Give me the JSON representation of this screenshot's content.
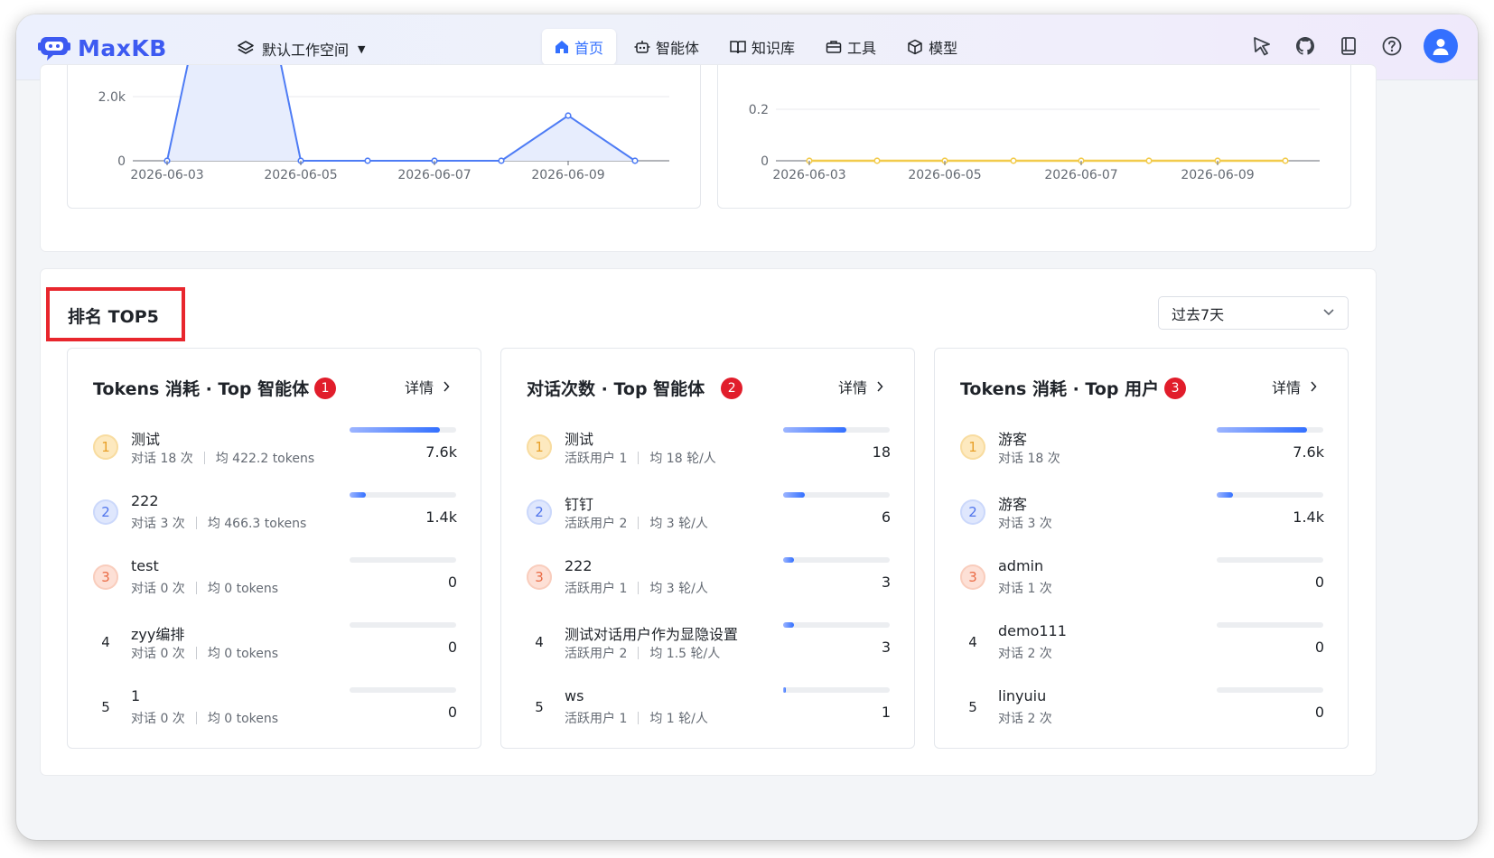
{
  "app": {
    "name": "MaxKB",
    "workspace": "默认工作空间"
  },
  "nav": [
    {
      "label": "首页",
      "icon": "home-icon",
      "active": true
    },
    {
      "label": "智能体",
      "icon": "robot-icon",
      "active": false
    },
    {
      "label": "知识库",
      "icon": "book-open-icon",
      "active": false
    },
    {
      "label": "工具",
      "icon": "toolbox-icon",
      "active": false
    },
    {
      "label": "模型",
      "icon": "cube-icon",
      "active": false
    }
  ],
  "header_icons": [
    "cursor-icon",
    "github-icon",
    "docs-icon",
    "help-icon",
    "user-avatar"
  ],
  "charts": {
    "left": {
      "y_ticks": [
        "2.0k",
        "0"
      ],
      "x_ticks": [
        "2026-06-03",
        "2026-06-05",
        "2026-06-07",
        "2026-06-09"
      ],
      "color": "#4e7cf5"
    },
    "right": {
      "y_ticks": [
        "0.2",
        "0"
      ],
      "x_ticks": [
        "2026-06-03",
        "2026-06-05",
        "2026-06-07",
        "2026-06-09"
      ],
      "color": "#f2cb4c"
    }
  },
  "ranking": {
    "title": "排名 TOP5",
    "period": "过去7天",
    "detail_label": "详情",
    "cards": [
      {
        "title": "Tokens 消耗 · Top 智能体",
        "badge": "1",
        "rows": [
          {
            "rank": "1",
            "name": "测试",
            "sub1": "对话 18 次",
            "sub2": "均 422.2 tokens",
            "value": "7.6k",
            "pct": 0.85
          },
          {
            "rank": "2",
            "name": "222",
            "sub1": "对话 3 次",
            "sub2": "均 466.3 tokens",
            "value": "1.4k",
            "pct": 0.15
          },
          {
            "rank": "3",
            "name": "test",
            "sub1": "对话 0 次",
            "sub2": "均 0 tokens",
            "value": "0",
            "pct": 0
          },
          {
            "rank": "4",
            "name": "zyy编排",
            "sub1": "对话 0 次",
            "sub2": "均 0 tokens",
            "value": "0",
            "pct": 0
          },
          {
            "rank": "5",
            "name": "1",
            "sub1": "对话 0 次",
            "sub2": "均 0 tokens",
            "value": "0",
            "pct": 0
          }
        ]
      },
      {
        "title": "对话次数 · Top 智能体",
        "badge": "2",
        "rows": [
          {
            "rank": "1",
            "name": "测试",
            "sub1": "活跃用户 1",
            "sub2": "均 18 轮/人",
            "value": "18",
            "pct": 0.59
          },
          {
            "rank": "2",
            "name": "钉钉",
            "sub1": "活跃用户 2",
            "sub2": "均 3 轮/人",
            "value": "6",
            "pct": 0.2
          },
          {
            "rank": "3",
            "name": "222",
            "sub1": "活跃用户 1",
            "sub2": "均 3 轮/人",
            "value": "3",
            "pct": 0.1
          },
          {
            "rank": "4",
            "name": "测试对话用户作为显隐设置",
            "sub1": "活跃用户 2",
            "sub2": "均 1.5 轮/人",
            "value": "3",
            "pct": 0.1
          },
          {
            "rank": "5",
            "name": "ws",
            "sub1": "活跃用户 1",
            "sub2": "均 1 轮/人",
            "value": "1",
            "pct": 0.03
          }
        ]
      },
      {
        "title": "Tokens 消耗 · Top 用户",
        "badge": "3",
        "rows": [
          {
            "rank": "1",
            "name": "游客",
            "sub1": "对话 18 次",
            "sub2": "",
            "value": "7.6k",
            "pct": 0.85
          },
          {
            "rank": "2",
            "name": "游客",
            "sub1": "对话 3 次",
            "sub2": "",
            "value": "1.4k",
            "pct": 0.15
          },
          {
            "rank": "3",
            "name": "admin",
            "sub1": "对话 1 次",
            "sub2": "",
            "value": "0",
            "pct": 0
          },
          {
            "rank": "4",
            "name": "demo111",
            "sub1": "对话 2 次",
            "sub2": "",
            "value": "0",
            "pct": 0
          },
          {
            "rank": "5",
            "name": "linyuiu",
            "sub1": "对话 2 次",
            "sub2": "",
            "value": "0",
            "pct": 0
          }
        ]
      }
    ]
  }
}
